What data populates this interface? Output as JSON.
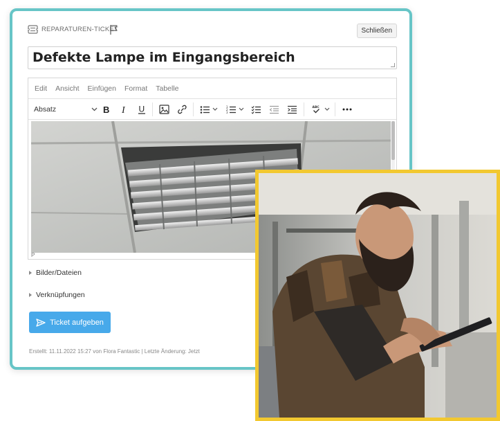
{
  "header": {
    "ticket_type_label": "REPARATUREN-TICKET",
    "close_label": "Schließen"
  },
  "ticket": {
    "title": "Defekte Lampe im Eingangsbereich"
  },
  "editor": {
    "menu": [
      "Edit",
      "Ansicht",
      "Einfügen",
      "Format",
      "Tabelle"
    ],
    "block_format": "Absatz",
    "status_path": "P"
  },
  "sections": {
    "files_label": "Bilder/Dateien",
    "links_label": "Verknüpfungen"
  },
  "actions": {
    "submit_label": "Ticket aufgeben"
  },
  "footer": {
    "meta": "Erstellt: 11.11.2022 15:27 von Flora Fantastic | Letzte Änderung: Jetzt"
  },
  "colors": {
    "card_border": "#67c5c7",
    "photo_border": "#f2c830",
    "primary_button": "#47a9ea"
  }
}
